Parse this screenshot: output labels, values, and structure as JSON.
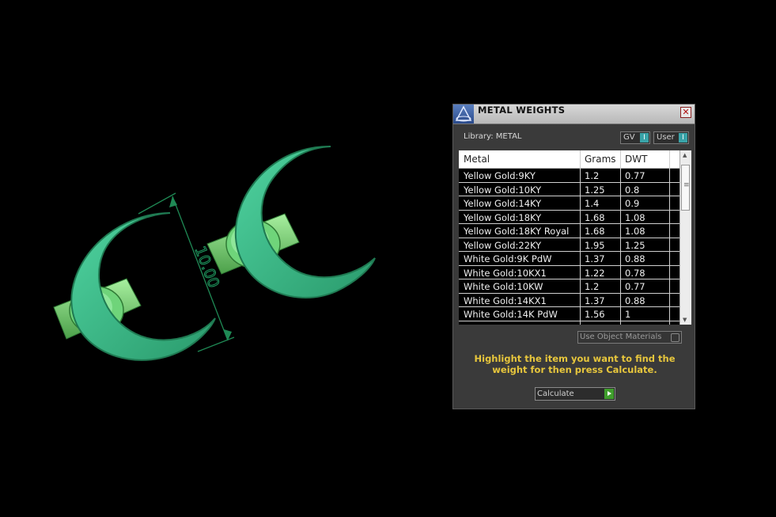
{
  "viewport": {
    "dimension_label": "10.00"
  },
  "panel": {
    "title": "METAL WEIGHTS",
    "close_symbol": "✕",
    "library_label": "Library: METAL",
    "toggle_gv": {
      "label": "GV",
      "knob": "I"
    },
    "toggle_user": {
      "label": "User",
      "knob": "I"
    },
    "table": {
      "columns": [
        "Metal",
        "Grams",
        "DWT"
      ],
      "rows": [
        [
          "Yellow Gold:9KY",
          "1.2",
          "0.77"
        ],
        [
          "Yellow Gold:10KY",
          "1.25",
          "0.8"
        ],
        [
          "Yellow Gold:14KY",
          "1.4",
          "0.9"
        ],
        [
          "Yellow Gold:18KY",
          "1.68",
          "1.08"
        ],
        [
          "Yellow Gold:18KY Royal",
          "1.68",
          "1.08"
        ],
        [
          "Yellow Gold:22KY",
          "1.95",
          "1.25"
        ],
        [
          "White Gold:9K PdW",
          "1.37",
          "0.88"
        ],
        [
          "White Gold:10KX1",
          "1.22",
          "0.78"
        ],
        [
          "White Gold:10KW",
          "1.2",
          "0.77"
        ],
        [
          "White Gold:14KX1",
          "1.37",
          "0.88"
        ],
        [
          "White Gold:14K PdW",
          "1.56",
          "1"
        ]
      ]
    },
    "use_object_materials": "Use Object Materials",
    "hint": "Highlight the item you want to find the weight for then press Calculate.",
    "calculate_label": "Calculate",
    "colors": {
      "hint_text": "#e7c63c",
      "model_green": "#3cb88a",
      "toggle_accent": "#39a3a8",
      "calc_arrow": "#3f9e2c"
    }
  }
}
